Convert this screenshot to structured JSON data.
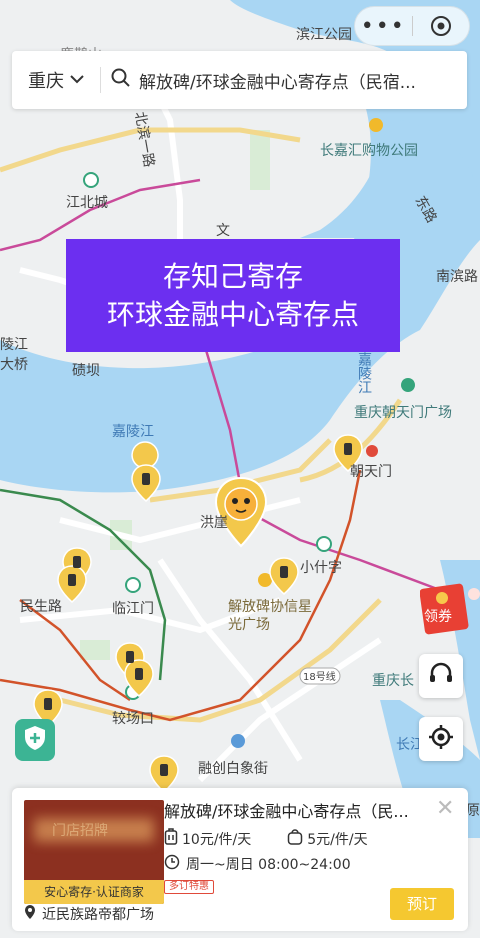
{
  "search": {
    "city": "重庆",
    "query": "解放碑/环球金融中心寄存点（民宿..."
  },
  "banner": {
    "line1": "存知己寄存",
    "line2": "环球金融中心寄存点"
  },
  "map_labels": {
    "binjiang_park": "滨江公园",
    "top_cut": "鹿鹊山",
    "beibin_road": "北滨一路",
    "changjia_mall": "长嘉汇购物公园",
    "jiangbei_city": "江北城",
    "wen": "文",
    "lingjiang_bridge": "陵江大桥",
    "qiqi": "碛坝",
    "jialing_river": "嘉陵江",
    "jialing_river2": "嘉陵江",
    "nanbin_road": "南滨路",
    "chaotianmen_square": "重庆朝天门广场",
    "chaotianmen": "朝天门",
    "hongyadong": "洪崖",
    "xiaoshizi": "小什字",
    "minsheng_road": "民生路",
    "linjiangmen": "临江门",
    "jiefangbei_plaza": "解放碑协信星光广场",
    "line18": "18号线",
    "jiaochangkou": "较场口",
    "rongchuang": "融创白象街",
    "chongqing_long": "重庆长",
    "changjiang": "长江",
    "east_road": "东路",
    "right_edge": "原"
  },
  "redpack_label": "领券",
  "card": {
    "title": "解放碑/环球金融中心寄存点（民...",
    "price_large": "10元/件/天",
    "price_small": "5元/件/天",
    "hours": "周一~周日 08:00~24:00",
    "tag": "多订特惠",
    "badge": "安心寄存·认证商家",
    "address": "近民族路帝都广场",
    "book_label": "预订",
    "thumb_text": "门店招牌"
  },
  "colors": {
    "water": "#a9d6f3",
    "land": "#eef0f1",
    "banner": "#6c2ff0",
    "accent": "#f5c830",
    "metro": "#c94a9a"
  }
}
